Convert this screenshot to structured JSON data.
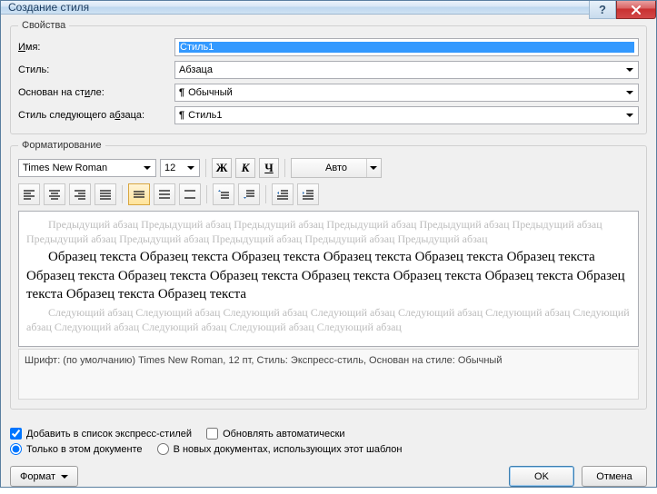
{
  "window": {
    "title": "Создание стиля"
  },
  "props_group": {
    "legend": "Свойства"
  },
  "labels": {
    "name": "Имя:",
    "styleType": "Стиль:",
    "basedOn": "Основан на стиле:",
    "nextPara": "Стиль следующего абзаца:"
  },
  "fields": {
    "name_value": "Стиль1",
    "styleType_value": "Абзаца",
    "basedOn_value": "Обычный",
    "nextPara_value": "Стиль1"
  },
  "format_group": {
    "legend": "Форматирование"
  },
  "toolbar": {
    "font": "Times New Roman",
    "size": "12",
    "bold": "Ж",
    "italic": "К",
    "underline": "Ч",
    "color": "Авто"
  },
  "preview": {
    "prev": "Предыдущий абзац Предыдущий абзац Предыдущий абзац Предыдущий абзац Предыдущий абзац Предыдущий абзац Предыдущий абзац Предыдущий абзац Предыдущий абзац Предыдущий абзац Предыдущий абзац",
    "sample": "Образец текста Образец текста Образец текста Образец текста Образец текста Образец текста Образец текста Образец текста Образец текста Образец текста Образец текста Образец текста Образец текста Образец текста Образец текста",
    "next": "Следующий абзац Следующий абзац Следующий абзац Следующий абзац Следующий абзац Следующий абзац Следующий абзац Следующий абзац Следующий абзац Следующий абзац Следующий абзац"
  },
  "description": "Шрифт: (по умолчанию) Times New Roman, 12 пт, Стиль: Экспресс-стиль, Основан на стиле: Обычный",
  "options": {
    "addQuick": "Добавить в список экспресс-стилей",
    "autoUpdate": "Обновлять автоматически",
    "docOnly": "Только в этом документе",
    "newDocs": "В новых документах, использующих этот шаблон"
  },
  "buttons": {
    "format": "Формат",
    "ok": "OK",
    "cancel": "Отмена"
  }
}
